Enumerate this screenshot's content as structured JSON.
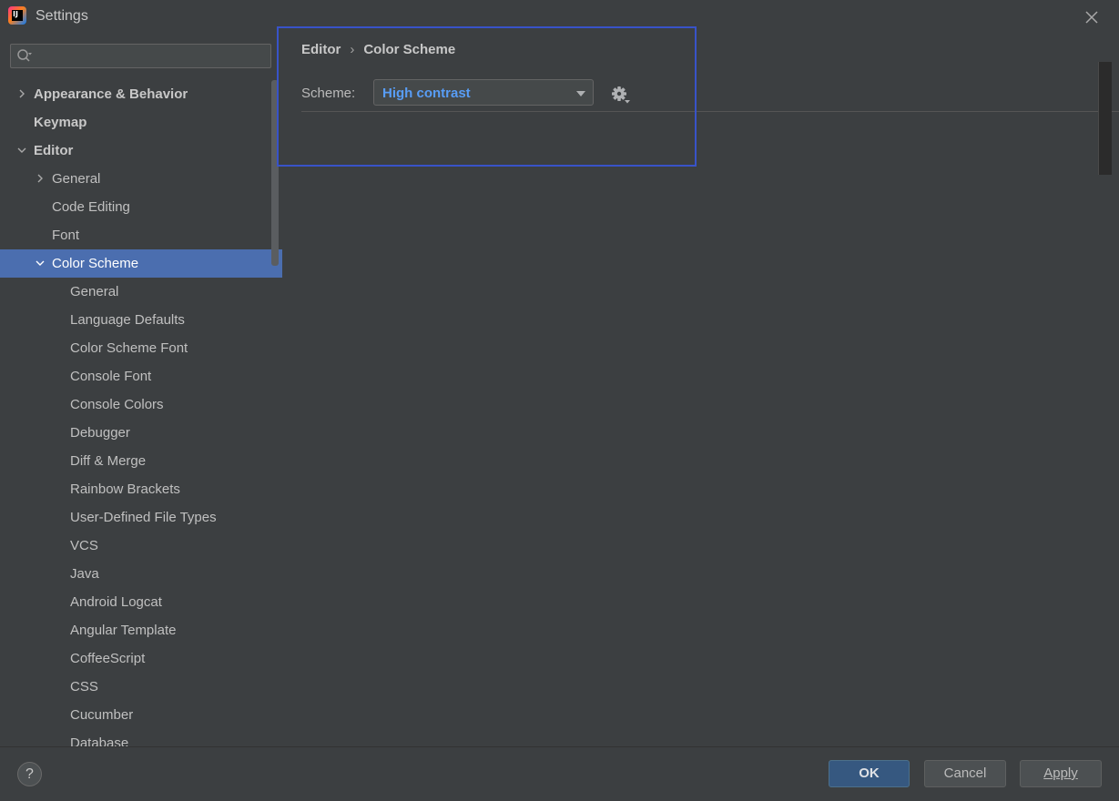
{
  "window": {
    "title": "Settings",
    "app_icon_text": "IJ"
  },
  "search": {
    "value": "",
    "placeholder": ""
  },
  "sidebar": {
    "items": [
      {
        "label": "Appearance & Behavior",
        "level": 0,
        "bold": true,
        "chevron": "right"
      },
      {
        "label": "Keymap",
        "level": 0,
        "bold": true,
        "chevron": "none"
      },
      {
        "label": "Editor",
        "level": 0,
        "bold": true,
        "chevron": "down"
      },
      {
        "label": "General",
        "level": 1,
        "bold": false,
        "chevron": "right"
      },
      {
        "label": "Code Editing",
        "level": 1,
        "bold": false,
        "chevron": "none"
      },
      {
        "label": "Font",
        "level": 1,
        "bold": false,
        "chevron": "none"
      },
      {
        "label": "Color Scheme",
        "level": 1,
        "bold": false,
        "chevron": "down",
        "selected": true
      },
      {
        "label": "General",
        "level": 2,
        "bold": false,
        "chevron": "none"
      },
      {
        "label": "Language Defaults",
        "level": 2,
        "bold": false,
        "chevron": "none"
      },
      {
        "label": "Color Scheme Font",
        "level": 2,
        "bold": false,
        "chevron": "none"
      },
      {
        "label": "Console Font",
        "level": 2,
        "bold": false,
        "chevron": "none"
      },
      {
        "label": "Console Colors",
        "level": 2,
        "bold": false,
        "chevron": "none"
      },
      {
        "label": "Debugger",
        "level": 2,
        "bold": false,
        "chevron": "none"
      },
      {
        "label": "Diff & Merge",
        "level": 2,
        "bold": false,
        "chevron": "none"
      },
      {
        "label": "Rainbow Brackets",
        "level": 2,
        "bold": false,
        "chevron": "none"
      },
      {
        "label": "User-Defined File Types",
        "level": 2,
        "bold": false,
        "chevron": "none"
      },
      {
        "label": "VCS",
        "level": 2,
        "bold": false,
        "chevron": "none"
      },
      {
        "label": "Java",
        "level": 2,
        "bold": false,
        "chevron": "none"
      },
      {
        "label": "Android Logcat",
        "level": 2,
        "bold": false,
        "chevron": "none"
      },
      {
        "label": "Angular Template",
        "level": 2,
        "bold": false,
        "chevron": "none"
      },
      {
        "label": "CoffeeScript",
        "level": 2,
        "bold": false,
        "chevron": "none"
      },
      {
        "label": "CSS",
        "level": 2,
        "bold": false,
        "chevron": "none"
      },
      {
        "label": "Cucumber",
        "level": 2,
        "bold": false,
        "chevron": "none"
      },
      {
        "label": "Database",
        "level": 2,
        "bold": false,
        "chevron": "none"
      }
    ]
  },
  "main": {
    "breadcrumb": [
      "Editor",
      "Color Scheme"
    ],
    "breadcrumb_separator": "›",
    "scheme_label": "Scheme:",
    "scheme_value": "High contrast"
  },
  "footer": {
    "help_label": "?",
    "ok_label": "OK",
    "cancel_label": "Cancel",
    "apply_label": "Apply"
  },
  "colors": {
    "background": "#3c3f41",
    "selection": "#4b6eaf",
    "scheme_value": "#589df6",
    "highlight_frame": "#3853c8",
    "ok_button": "#365880"
  }
}
